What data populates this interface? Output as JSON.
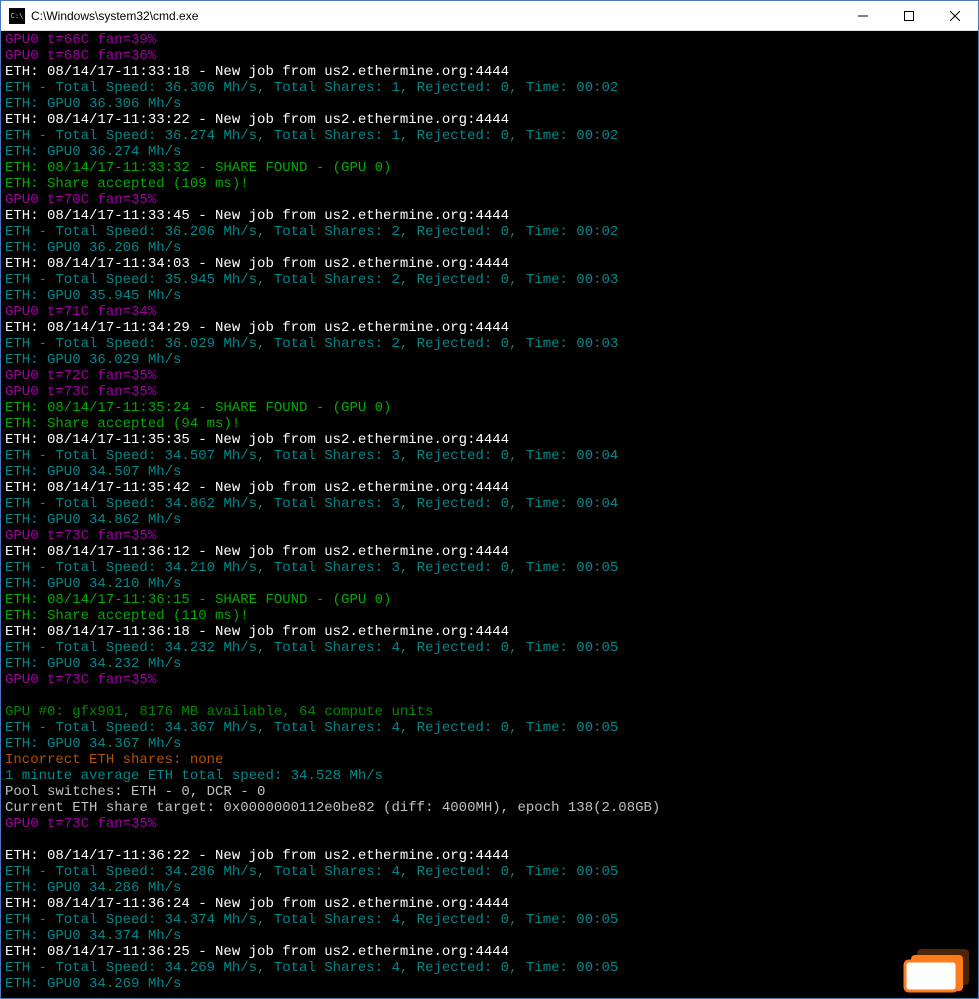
{
  "window": {
    "title": "C:\\Windows\\system32\\cmd.exe"
  },
  "lines": [
    {
      "cls": "c-magenta",
      "text": "GPU0 t=66C fan=39%"
    },
    {
      "cls": "c-magenta",
      "text": "GPU0 t=68C fan=36%"
    },
    {
      "cls": "c-white",
      "text": "ETH: 08/14/17-11:33:18 - New job from us2.ethermine.org:4444"
    },
    {
      "cls": "c-teal",
      "text": "ETH - Total Speed: 36.306 Mh/s, Total Shares: 1, Rejected: 0, Time: 00:02"
    },
    {
      "cls": "c-teal",
      "text": "ETH: GPU0 36.306 Mh/s"
    },
    {
      "cls": "c-white",
      "text": "ETH: 08/14/17-11:33:22 - New job from us2.ethermine.org:4444"
    },
    {
      "cls": "c-teal",
      "text": "ETH - Total Speed: 36.274 Mh/s, Total Shares: 1, Rejected: 0, Time: 00:02"
    },
    {
      "cls": "c-teal",
      "text": "ETH: GPU0 36.274 Mh/s"
    },
    {
      "cls": "c-green",
      "text": "ETH: 08/14/17-11:33:32 - SHARE FOUND - (GPU 0)"
    },
    {
      "cls": "c-green",
      "text": "ETH: Share accepted (109 ms)!"
    },
    {
      "cls": "c-magenta",
      "text": "GPU0 t=70C fan=35%"
    },
    {
      "cls": "c-white",
      "text": "ETH: 08/14/17-11:33:45 - New job from us2.ethermine.org:4444"
    },
    {
      "cls": "c-teal",
      "text": "ETH - Total Speed: 36.206 Mh/s, Total Shares: 2, Rejected: 0, Time: 00:02"
    },
    {
      "cls": "c-teal",
      "text": "ETH: GPU0 36.206 Mh/s"
    },
    {
      "cls": "c-white",
      "text": "ETH: 08/14/17-11:34:03 - New job from us2.ethermine.org:4444"
    },
    {
      "cls": "c-teal",
      "text": "ETH - Total Speed: 35.945 Mh/s, Total Shares: 2, Rejected: 0, Time: 00:03"
    },
    {
      "cls": "c-teal",
      "text": "ETH: GPU0 35.945 Mh/s"
    },
    {
      "cls": "c-magenta",
      "text": "GPU0 t=71C fan=34%"
    },
    {
      "cls": "c-white",
      "text": "ETH: 08/14/17-11:34:29 - New job from us2.ethermine.org:4444"
    },
    {
      "cls": "c-teal",
      "text": "ETH - Total Speed: 36.029 Mh/s, Total Shares: 2, Rejected: 0, Time: 00:03"
    },
    {
      "cls": "c-teal",
      "text": "ETH: GPU0 36.029 Mh/s"
    },
    {
      "cls": "c-magenta",
      "text": "GPU0 t=72C fan=35%"
    },
    {
      "cls": "c-magenta",
      "text": "GPU0 t=73C fan=35%"
    },
    {
      "cls": "c-green",
      "text": "ETH: 08/14/17-11:35:24 - SHARE FOUND - (GPU 0)"
    },
    {
      "cls": "c-green",
      "text": "ETH: Share accepted (94 ms)!"
    },
    {
      "cls": "c-white",
      "text": "ETH: 08/14/17-11:35:35 - New job from us2.ethermine.org:4444"
    },
    {
      "cls": "c-teal",
      "text": "ETH - Total Speed: 34.507 Mh/s, Total Shares: 3, Rejected: 0, Time: 00:04"
    },
    {
      "cls": "c-teal",
      "text": "ETH: GPU0 34.507 Mh/s"
    },
    {
      "cls": "c-white",
      "text": "ETH: 08/14/17-11:35:42 - New job from us2.ethermine.org:4444"
    },
    {
      "cls": "c-teal",
      "text": "ETH - Total Speed: 34.862 Mh/s, Total Shares: 3, Rejected: 0, Time: 00:04"
    },
    {
      "cls": "c-teal",
      "text": "ETH: GPU0 34.862 Mh/s"
    },
    {
      "cls": "c-magenta",
      "text": "GPU0 t=73C fan=35%"
    },
    {
      "cls": "c-white",
      "text": "ETH: 08/14/17-11:36:12 - New job from us2.ethermine.org:4444"
    },
    {
      "cls": "c-teal",
      "text": "ETH - Total Speed: 34.210 Mh/s, Total Shares: 3, Rejected: 0, Time: 00:05"
    },
    {
      "cls": "c-teal",
      "text": "ETH: GPU0 34.210 Mh/s"
    },
    {
      "cls": "c-green",
      "text": "ETH: 08/14/17-11:36:15 - SHARE FOUND - (GPU 0)"
    },
    {
      "cls": "c-green",
      "text": "ETH: Share accepted (110 ms)!"
    },
    {
      "cls": "c-white",
      "text": "ETH: 08/14/17-11:36:18 - New job from us2.ethermine.org:4444"
    },
    {
      "cls": "c-teal",
      "text": "ETH - Total Speed: 34.232 Mh/s, Total Shares: 4, Rejected: 0, Time: 00:05"
    },
    {
      "cls": "c-teal",
      "text": "ETH: GPU0 34.232 Mh/s"
    },
    {
      "cls": "c-magenta",
      "text": "GPU0 t=73C fan=35%"
    },
    {
      "cls": "c-white",
      "text": ""
    },
    {
      "cls": "c-dgreen",
      "text": "GPU #0: gfx901, 8176 MB available, 64 compute units"
    },
    {
      "cls": "c-teal",
      "text": "ETH - Total Speed: 34.367 Mh/s, Total Shares: 4, Rejected: 0, Time: 00:05"
    },
    {
      "cls": "c-teal",
      "text": "ETH: GPU0 34.367 Mh/s"
    },
    {
      "cls": "c-orange",
      "text": "Incorrect ETH shares: none"
    },
    {
      "cls": "c-teal",
      "text": "1 minute average ETH total speed: 34.528 Mh/s"
    },
    {
      "cls": "c-gray",
      "text": "Pool switches: ETH - 0, DCR - 0"
    },
    {
      "cls": "c-gray",
      "text": "Current ETH share target: 0x0000000112e0be82 (diff: 4000MH), epoch 138(2.08GB)"
    },
    {
      "cls": "c-magenta",
      "text": "GPU0 t=73C fan=35%"
    },
    {
      "cls": "c-white",
      "text": ""
    },
    {
      "cls": "c-white",
      "text": "ETH: 08/14/17-11:36:22 - New job from us2.ethermine.org:4444"
    },
    {
      "cls": "c-teal",
      "text": "ETH - Total Speed: 34.286 Mh/s, Total Shares: 4, Rejected: 0, Time: 00:05"
    },
    {
      "cls": "c-teal",
      "text": "ETH: GPU0 34.286 Mh/s"
    },
    {
      "cls": "c-white",
      "text": "ETH: 08/14/17-11:36:24 - New job from us2.ethermine.org:4444"
    },
    {
      "cls": "c-teal",
      "text": "ETH - Total Speed: 34.374 Mh/s, Total Shares: 4, Rejected: 0, Time: 00:05"
    },
    {
      "cls": "c-teal",
      "text": "ETH: GPU0 34.374 Mh/s"
    },
    {
      "cls": "c-white",
      "text": "ETH: 08/14/17-11:36:25 - New job from us2.ethermine.org:4444"
    },
    {
      "cls": "c-teal",
      "text": "ETH - Total Speed: 34.269 Mh/s, Total Shares: 4, Rejected: 0, Time: 00:05"
    },
    {
      "cls": "c-teal",
      "text": "ETH: GPU0 34.269 Mh/s"
    }
  ]
}
